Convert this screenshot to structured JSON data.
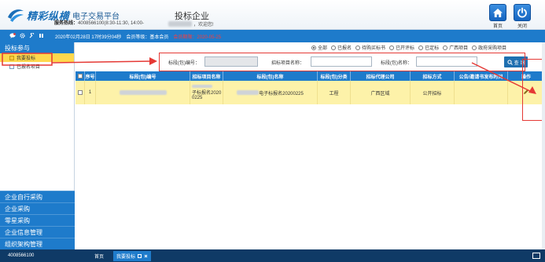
{
  "header": {
    "brand": "精彩纵横",
    "subtitle": "电子交易平台",
    "hotline_label": "服务热线：",
    "hotline_value": "4008566100(8:30-11:30, 14:00-",
    "page_title": "投标企业",
    "welcome": "，欢迎您!",
    "home_label": "首页",
    "close_label": "关闭"
  },
  "bluebar": {
    "datetime": "2020年02月28日 17时39分04秒",
    "level": "会员等级：基本会员",
    "expire": "会员期限：2020-05-25"
  },
  "sidebar": {
    "title": "投标参与",
    "items": [
      {
        "label": "我要投标"
      },
      {
        "label": "已报名项目"
      }
    ],
    "categories": [
      {
        "label": "企业自行采购"
      },
      {
        "label": "企业采购"
      },
      {
        "label": "零星采购"
      },
      {
        "label": "企业信息管理"
      },
      {
        "label": "组织架构管理"
      }
    ]
  },
  "filters": {
    "radios": [
      {
        "label": "全部",
        "checked": true
      },
      {
        "label": "已报名",
        "checked": false
      },
      {
        "label": "待购买标书",
        "checked": false
      },
      {
        "label": "已开评标",
        "checked": false
      },
      {
        "label": "已定标",
        "checked": false
      },
      {
        "label": "广西项目",
        "checked": false
      },
      {
        "label": "政府采购项目",
        "checked": false
      }
    ],
    "code_label": "标段(包)编号：",
    "project_name_label": "招标项目名称：",
    "package_name_label": "标段(包)名称：",
    "search_label": "查 询"
  },
  "table": {
    "headers": [
      "序号",
      "标段(包)编号",
      "招标项目名称",
      "标段(包)名称",
      "标段(包)分类",
      "招标代理公司",
      "招标方式",
      "公告/邀请书发布时间",
      "操作"
    ],
    "rows": [
      {
        "index": "1",
        "project_name_line1": "子标报名2020",
        "project_name_line2": "0225",
        "package_name": "电子标报名20200225",
        "category": "工程",
        "agency": "广西区域",
        "method": "公开招标",
        "publish_time": ""
      }
    ]
  },
  "footer": {
    "phone": "4008566100",
    "tabs": [
      {
        "label": "首页"
      },
      {
        "label": "我要投标"
      }
    ]
  },
  "colors": {
    "primary_blue": "#1e7bcb",
    "highlight_yellow": "#fdf2a9",
    "annotation_red": "#e53935",
    "footer_navy": "#0f3a66"
  }
}
